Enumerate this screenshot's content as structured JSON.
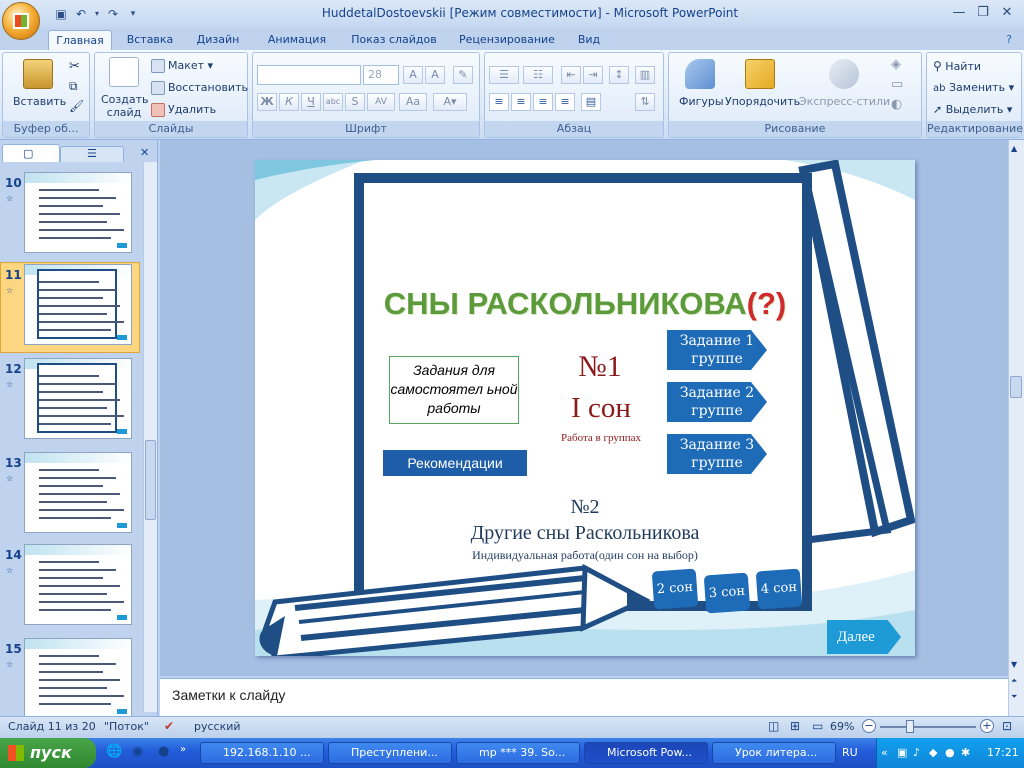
{
  "window": {
    "title": "HuddetalDostoevskii [Режим совместимости] - Microsoft PowerPoint"
  },
  "tabs": [
    "Главная",
    "Вставка",
    "Дизайн",
    "Анимация",
    "Показ слайдов",
    "Рецензирование",
    "Вид"
  ],
  "ribbon": {
    "clipboard": {
      "label": "Буфер об...",
      "paste": "Вставить"
    },
    "slides": {
      "label": "Слайды",
      "new_slide": "Создать слайд",
      "layout": "Макет",
      "reset": "Восстановить",
      "delete": "Удалить"
    },
    "font": {
      "label": "Шрифт",
      "font_size": "28"
    },
    "paragraph": {
      "label": "Абзац"
    },
    "drawing": {
      "label": "Рисование",
      "shapes": "Фигуры",
      "arrange": "Упорядочить",
      "quick_styles": "Экспресс-стили"
    },
    "editing": {
      "label": "Редактирование",
      "find": "Найти",
      "replace": "Заменить",
      "select": "Выделить"
    }
  },
  "thumbnails": [
    {
      "num": "10"
    },
    {
      "num": "11"
    },
    {
      "num": "12"
    },
    {
      "num": "13"
    },
    {
      "num": "14"
    },
    {
      "num": "15"
    }
  ],
  "slide": {
    "title_main": "СНЫ  РАСКОЛЬНИКОВА",
    "title_suffix": "(?)",
    "tasks_box": "Задания  для самостоятел ьной  работы",
    "recommendations": "Рекомендации",
    "num1": "№1",
    "son1": "I  сон",
    "group_work": "Работа в группах",
    "task1": "Задание 1 группе",
    "task2": "Задание 2 группе",
    "task3": "Задание 3 группе",
    "num2": "№2",
    "other_dreams": "Другие  сны  Раскольникова",
    "individual": "Индивидуальная работа(один сон  на выбор)",
    "son2": "2 сон",
    "son3": "3 сон",
    "son4": "4 сон",
    "next": "Далее"
  },
  "notes_placeholder": "Заметки к слайду",
  "status": {
    "slide_counter": "Слайд 11 из 20",
    "theme": "\"Поток\"",
    "language": "русский",
    "zoom": "69%"
  },
  "taskbar": {
    "start": "пуск",
    "tasks": [
      "192.168.1.10 ...",
      "Преступлени...",
      "mp *** 39. So...",
      "Microsoft Pow...",
      "Урок  литера..."
    ],
    "lang": "RU",
    "time": "17:21"
  }
}
